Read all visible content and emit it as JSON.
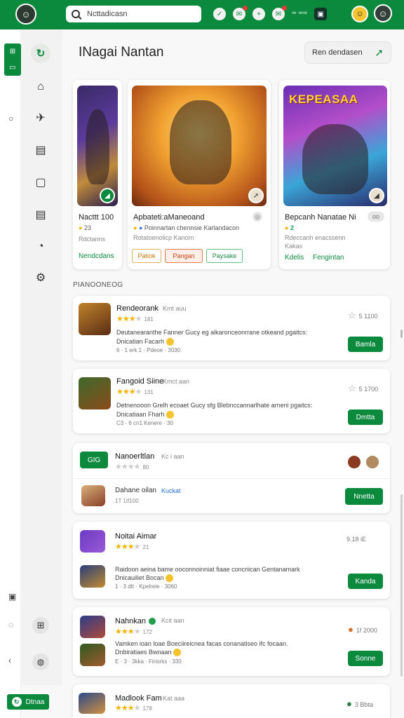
{
  "topbar": {
    "search_text": "Ncttadicasn",
    "counter": "ꟹ ꟹꟹ",
    "icons": [
      "check-icon",
      "chat-icon",
      "plus-icon",
      "message-icon",
      "counter-text",
      "wallet-icon",
      "coin-icon",
      "user-avatar"
    ]
  },
  "rail": {
    "chip": "⊞",
    "bottom_chip": "Dtnaa"
  },
  "header": {
    "title": "INagai Nantan",
    "filter": "Ren dendasen"
  },
  "featured": [
    {
      "title": "Nacttt 100",
      "rating": "23",
      "link": "Nendcdans"
    },
    {
      "title": "Apbateti:aManeoand",
      "tags": [
        "Patiok",
        "Pangan",
        "Paysake"
      ]
    },
    {
      "title": "Bepcanh Nanatae Ni",
      "rating": "2",
      "meta": "Rdeccanh enacssenn",
      "sub": "Kakas",
      "links": [
        "Kdelis",
        "Fengintan"
      ],
      "logo": "KEPEASAA"
    }
  ],
  "section_label": "PIANOONEOG",
  "list": [
    {
      "title": "Rendeorank",
      "sub": "Kmt auu",
      "stars": 3,
      "num": "181",
      "desc1": "Deutanearanthe Fanner Gucy eg alkaronceonrrane otkeand pgaitcs:",
      "desc2": "Dnicatian Facarh",
      "meta": "6 · 1 erk 1 · Pdeoe · 3030",
      "count": "5 1100",
      "btn": "Bamla"
    },
    {
      "title": "Fangoid Siine",
      "sub": "Kmct aan",
      "stars": 3,
      "num": "131",
      "desc1": "Detnenooon Grelh ecoaet Gucy sfg Blebnccannarlhate arneni pgaitcs:",
      "desc2": "Dnicatiaan Fharh",
      "meta": "C3 · 6 cn1 Kenere · 30",
      "count": "5 1700",
      "btn": "Dmtta"
    },
    {
      "title": "Nanoerltlan",
      "sub": "Kc i aan",
      "stars": 0,
      "num": "80",
      "chip": "GIG",
      "btn": "Nnetta",
      "sub_title": "Dahane oilan",
      "sub_link": "Kuckat",
      "sub_meta": "1T 1tf100"
    },
    {
      "title": "Noitai Aimar",
      "stars": 3,
      "num": "21",
      "desc1": "Raidoon aeina bame ooconnoinniat fiaae concriican Gentanamark",
      "desc2": "Dnicauiliet Bocan",
      "meta": "1 · 3 dtt · Kpelreie · 3060",
      "count": "9.18 iE",
      "btn": "Kanda"
    },
    {
      "title": "Nahnkan",
      "sub": "Kcit aan",
      "stars": 3,
      "num": "172",
      "desc1": "Vamken ioan loae Boeciireicnea facas conanatiseo ifc focaan.",
      "desc2": "Dnbiratiaes Bwnaan",
      "meta": "E · 3 · 3kka · Firiorks · 330",
      "count": "1f 2000",
      "btn": "Sonne"
    },
    {
      "title": "Madlook Fam",
      "sub": "Kat aaa",
      "stars": 3,
      "num": "178",
      "count": "3 Bbta"
    }
  ],
  "colors": {
    "brand": "#0b8a3e",
    "star": "#f4b400"
  }
}
